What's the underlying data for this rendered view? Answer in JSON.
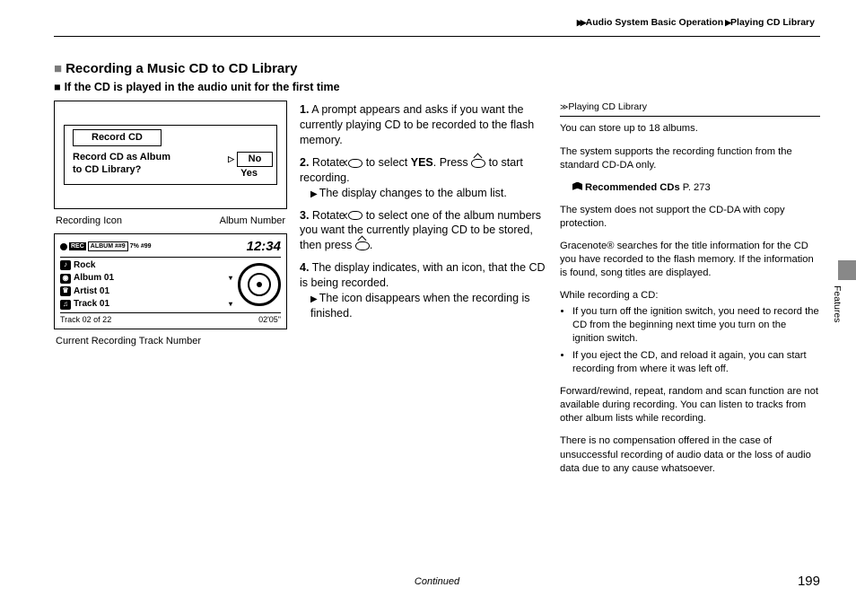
{
  "breadcrumb": {
    "level1": "Audio System Basic Operation",
    "level2": "Playing CD Library"
  },
  "section": {
    "title": "Recording a Music CD to CD Library",
    "subtitle": "If the CD is played in the audio unit for the first time"
  },
  "illustration1": {
    "box_title": "Record CD",
    "question_l1": "Record CD as Album",
    "question_l2": "to CD Library?",
    "option_no": "No",
    "option_yes": "Yes"
  },
  "labels1": {
    "left": "Recording Icon",
    "right": "Album Number"
  },
  "illustration2": {
    "rec_label": "REC",
    "album_top": "ALBUM ##9",
    "pct": "7%",
    "remain": "#99",
    "clock": "12:34",
    "genre": "Rock",
    "album": "Album 01",
    "artist": "Artist 01",
    "track": "Track 01",
    "track_of": "Track 02 of 22",
    "elapsed": "02'05\""
  },
  "label_below2": "Current Recording Track Number",
  "steps": {
    "s1": "A prompt appears and asks if you want the currently playing CD to be recorded to the flash memory.",
    "s2a": "Rotate ",
    "s2b": " to select ",
    "s2_yes": "YES",
    "s2c": ". Press ",
    "s2d": " to start recording.",
    "s2_sub": "The display changes to the album list.",
    "s3a": "Rotate ",
    "s3b": " to select one of the album numbers you want the currently playing CD to be stored, then press ",
    "s3c": ".",
    "s4": "The display indicates, with an icon, that the CD is being recorded.",
    "s4_sub": "The icon disappears when the recording is finished."
  },
  "sidebar": {
    "title": "Playing CD Library",
    "p1": "You can store up to 18 albums.",
    "p2": "The system supports the recording function from the standard CD-DA only.",
    "link_label": "Recommended CDs",
    "link_page": "P. 273",
    "p3": "The system does not support the CD-DA with copy protection.",
    "p4": "Gracenote® searches for the title information for the CD you have recorded to the flash memory. If the information is found, song titles are displayed.",
    "list_intro": "While recording a CD:",
    "li1": "If you turn off the ignition switch, you need to record the CD from the beginning next time you turn on the ignition switch.",
    "li2": "If you eject the CD, and reload it again, you can start recording from where it was left off.",
    "p5": "Forward/rewind, repeat, random and scan function are not available during recording. You can listen to tracks from other album lists while recording.",
    "p6": "There is no compensation offered in the case of unsuccessful recording of audio data or the loss of audio data due to any cause whatsoever."
  },
  "edge": {
    "features": "Features"
  },
  "footer": {
    "continued": "Continued",
    "page": "199"
  }
}
